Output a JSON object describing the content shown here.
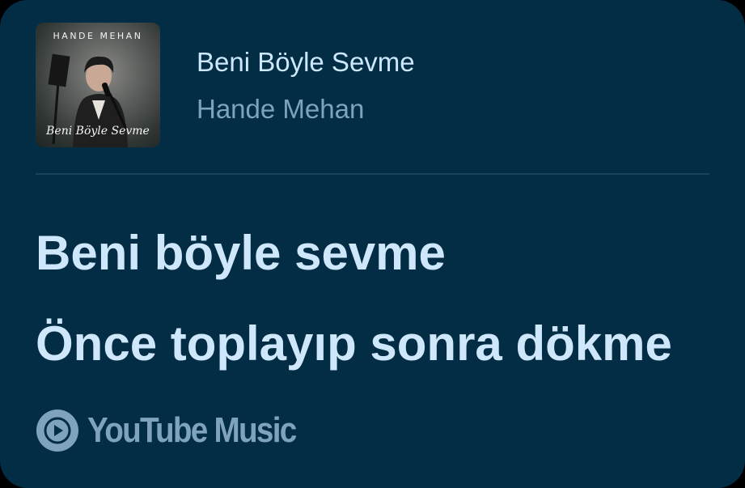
{
  "track": {
    "title": "Beni Böyle Sevme",
    "artist": "Hande Mehan",
    "cover": {
      "artist_text": "HANDE MEHAN",
      "script_text": "Beni Böyle Sevme"
    }
  },
  "lyrics": [
    "Beni böyle sevme",
    "Önce toplayıp sonra dökme"
  ],
  "brand": {
    "name": "YouTube Music",
    "icon": "play-circle-icon"
  },
  "colors": {
    "background": "#022d44",
    "title": "#cde7fb",
    "secondary": "#7fa3bd",
    "lyrics": "#cfe7fb",
    "divider": "#17435d"
  }
}
